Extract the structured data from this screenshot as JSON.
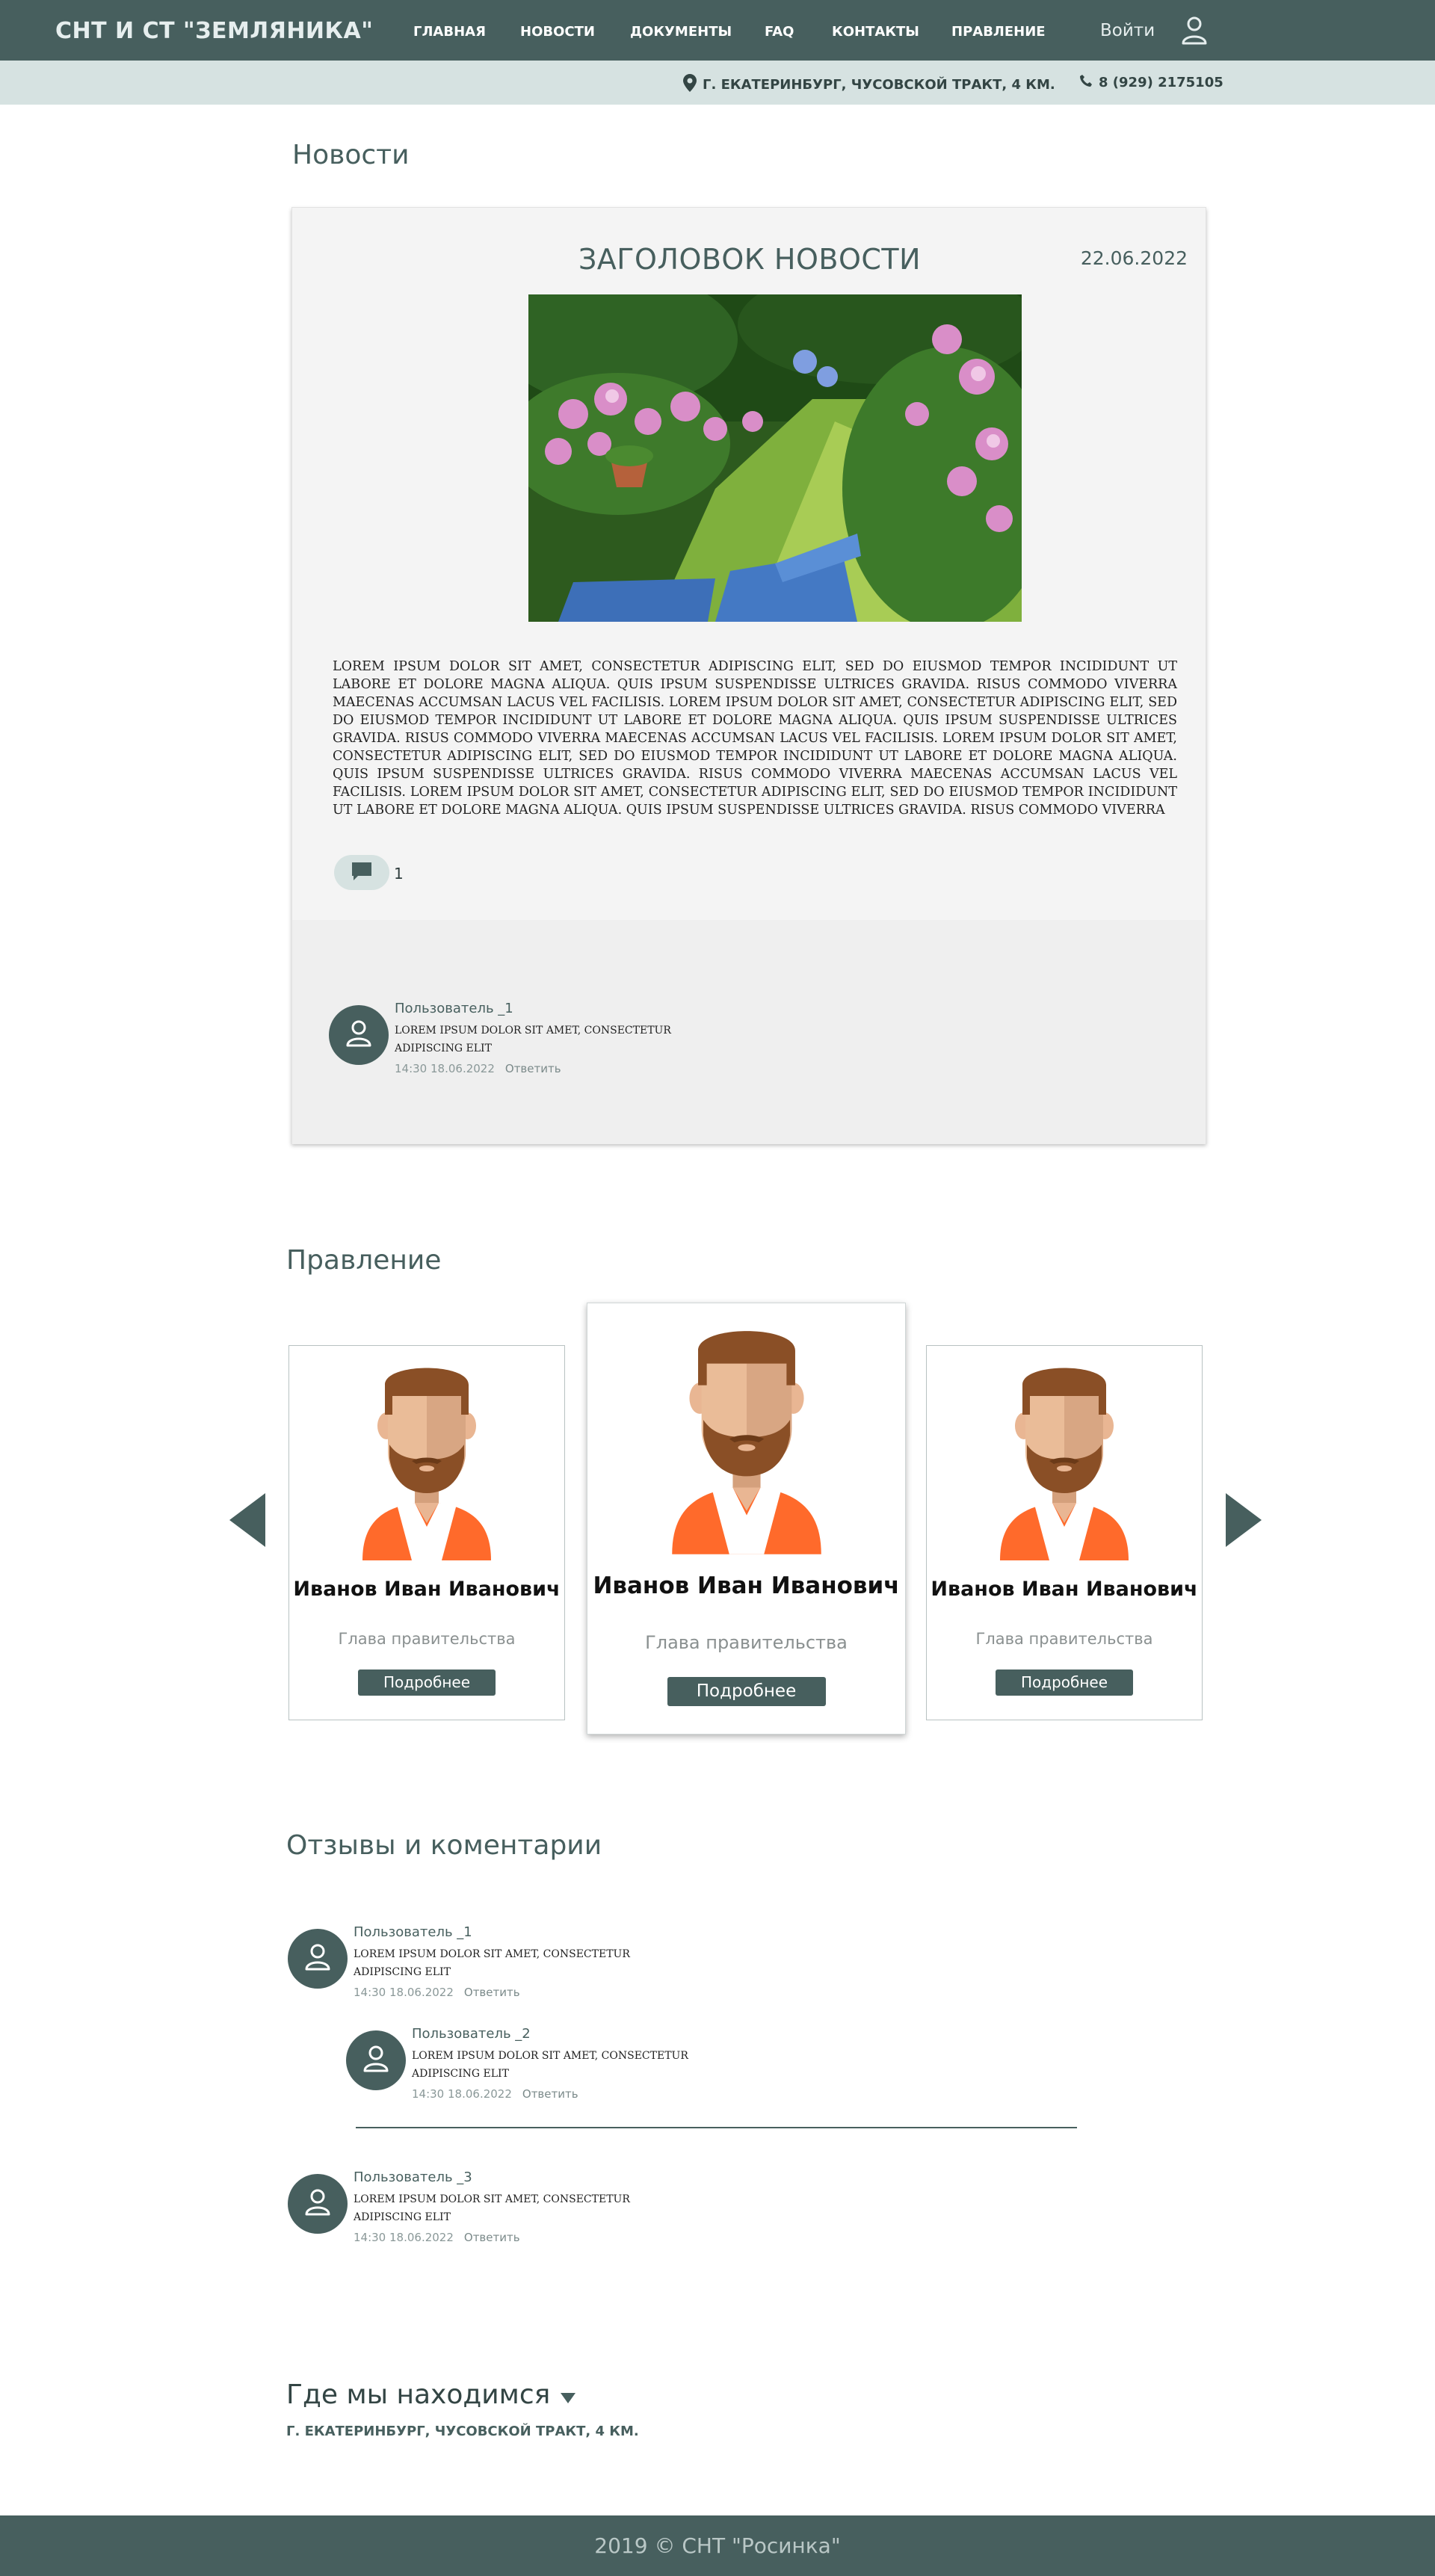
{
  "header": {
    "logo": "СНТ И СТ \"ЗЕМЛЯНИКА\"",
    "nav": [
      "ГЛАВНАЯ",
      "НОВОСТИ",
      "ДОКУМЕНТЫ",
      "FAQ",
      "КОНТАКТЫ",
      "ПРАВЛЕНИЕ"
    ],
    "login": "Войти",
    "address": "Г. ЕКАТЕРИНБУРГ, ЧУСОВСКОЙ ТРАКТ, 4 КМ.",
    "phone": "8 (929) 2175105"
  },
  "news": {
    "section_title": "Новости",
    "title": "ЗАГОЛОВОК НОВОСТИ",
    "date": "22.06.2022",
    "text": "Lorem ipsum dolor sit amet, consectetur adipiscing elit, sed do eiusmod tempor incididunt ut labore et dolore magna aliqua. Quis ipsum suspendisse ultrices gravida. Risus commodo viverra maecenas accumsan lacus vel facilisis. Lorem ipsum dolor sit amet, consectetur adipiscing elit, sed do eiusmod tempor incididunt ut labore et dolore magna aliqua. Quis ipsum suspendisse ultrices gravida. Risus commodo viverra maecenas accumsan lacus vel facilisis. Lorem ipsum dolor sit amet, consectetur adipiscing elit, sed do eiusmod tempor incididunt ut labore et dolore magna aliqua. Quis ipsum suspendisse ultrices gravida. Risus commodo viverra maecenas accumsan lacus vel facilisis. Lorem ipsum dolor sit amet, consectetur adipiscing elit, sed do eiusmod tempor incididunt ut labore et dolore magna aliqua. Quis ipsum suspendisse ultrices gravida. Risus commodo viverra",
    "comment_count": "1",
    "comment": {
      "user": "Пользователь _1",
      "text": "Lorem ipsum dolor sit amet, consectetur adipiscing elit",
      "time": "14:30 18.06.2022",
      "reply": "Ответить"
    }
  },
  "board": {
    "section_title": "Правление",
    "members": [
      {
        "name": "Иванов Иван Иванович",
        "role": "Глава правительства",
        "button": "Подробнее"
      },
      {
        "name": "Иванов Иван Иванович",
        "role": "Глава правительства",
        "button": "Подробнее"
      },
      {
        "name": "Иванов Иван Иванович",
        "role": "Глава правительства",
        "button": "Подробнее"
      }
    ]
  },
  "reviews": {
    "section_title": "Отзывы и коментарии",
    "items": [
      {
        "user": "Пользователь _1",
        "text": "Lorem ipsum dolor sit amet, consectetur adipiscing elit",
        "time": "14:30 18.06.2022",
        "reply": "Ответить"
      },
      {
        "user": "Пользователь _2",
        "text": "Lorem ipsum dolor sit amet, consectetur adipiscing elit",
        "time": "14:30 18.06.2022",
        "reply": "Ответить"
      },
      {
        "user": "Пользователь _3",
        "text": "Lorem ipsum dolor sit amet, consectetur adipiscing elit",
        "time": "14:30 18.06.2022",
        "reply": "Ответить"
      }
    ]
  },
  "location": {
    "title": "Где мы находимся",
    "address": "Г. ЕКАТЕРИНБУРГ, ЧУСОВСКОЙ ТРАКТ, 4 КМ."
  },
  "footer": {
    "text": "2019 © СНТ \"Росинка\""
  },
  "colors": {
    "primary": "#475f5e",
    "subbar": "#d6e2e1",
    "accent_orange": "#f25c25"
  }
}
